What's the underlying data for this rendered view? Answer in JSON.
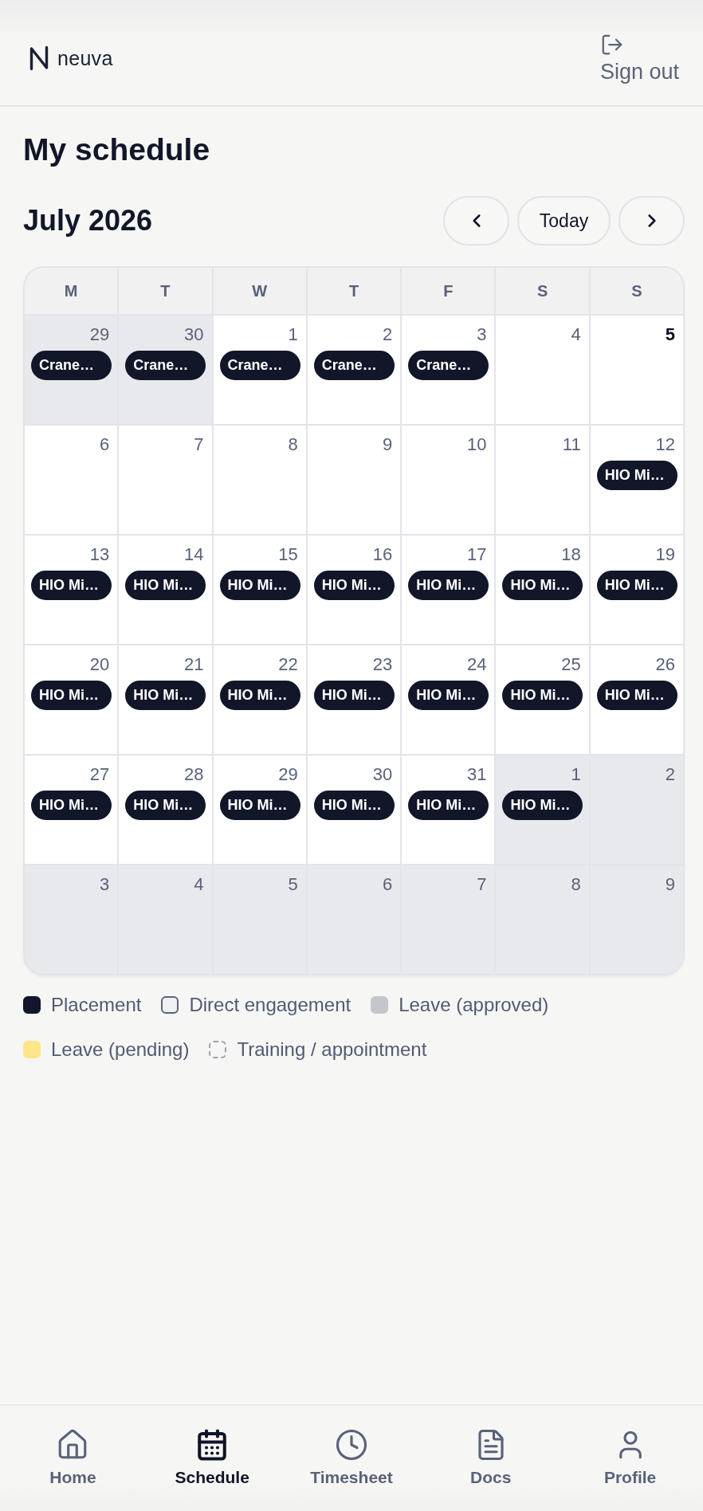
{
  "header": {
    "brand": "neuva",
    "sign_out": "Sign out"
  },
  "page_title": "My schedule",
  "month": {
    "title": "July 2026",
    "today_button": "Today"
  },
  "weekdays": [
    "M",
    "T",
    "W",
    "T",
    "F",
    "S",
    "S"
  ],
  "weeks": [
    {
      "days": [
        {
          "day": "29",
          "in_month": false,
          "today": false,
          "events": [
            {
              "label": "Crane…",
              "kind": "placement"
            }
          ]
        },
        {
          "day": "30",
          "in_month": false,
          "today": false,
          "events": [
            {
              "label": "Crane…",
              "kind": "placement"
            }
          ]
        },
        {
          "day": "1",
          "in_month": true,
          "today": false,
          "events": [
            {
              "label": "Crane…",
              "kind": "placement"
            }
          ]
        },
        {
          "day": "2",
          "in_month": true,
          "today": false,
          "events": [
            {
              "label": "Crane…",
              "kind": "placement"
            }
          ]
        },
        {
          "day": "3",
          "in_month": true,
          "today": false,
          "events": [
            {
              "label": "Crane…",
              "kind": "placement"
            }
          ]
        },
        {
          "day": "4",
          "in_month": true,
          "today": false
        },
        {
          "day": "5",
          "in_month": true,
          "today": true
        }
      ]
    },
    {
      "days": [
        {
          "day": "6",
          "in_month": true,
          "today": false
        },
        {
          "day": "7",
          "in_month": true,
          "today": false
        },
        {
          "day": "8",
          "in_month": true,
          "today": false
        },
        {
          "day": "9",
          "in_month": true,
          "today": false
        },
        {
          "day": "10",
          "in_month": true,
          "today": false
        },
        {
          "day": "11",
          "in_month": true,
          "today": false
        },
        {
          "day": "12",
          "in_month": true,
          "today": false,
          "events": [
            {
              "label": "HIO Mi…",
              "kind": "placement"
            }
          ]
        }
      ]
    },
    {
      "days": [
        {
          "day": "13",
          "in_month": true,
          "today": false,
          "events": [
            {
              "label": "HIO Mi…",
              "kind": "placement"
            }
          ]
        },
        {
          "day": "14",
          "in_month": true,
          "today": false,
          "events": [
            {
              "label": "HIO Mi…",
              "kind": "placement"
            }
          ]
        },
        {
          "day": "15",
          "in_month": true,
          "today": false,
          "events": [
            {
              "label": "HIO Mi…",
              "kind": "placement"
            }
          ]
        },
        {
          "day": "16",
          "in_month": true,
          "today": false,
          "events": [
            {
              "label": "HIO Mi…",
              "kind": "placement"
            }
          ]
        },
        {
          "day": "17",
          "in_month": true,
          "today": false,
          "events": [
            {
              "label": "HIO Mi…",
              "kind": "placement"
            }
          ]
        },
        {
          "day": "18",
          "in_month": true,
          "today": false,
          "events": [
            {
              "label": "HIO Mi…",
              "kind": "placement"
            }
          ]
        },
        {
          "day": "19",
          "in_month": true,
          "today": false,
          "events": [
            {
              "label": "HIO Mi…",
              "kind": "placement"
            }
          ]
        }
      ]
    },
    {
      "days": [
        {
          "day": "20",
          "in_month": true,
          "today": false,
          "events": [
            {
              "label": "HIO Mi…",
              "kind": "placement"
            }
          ]
        },
        {
          "day": "21",
          "in_month": true,
          "today": false,
          "events": [
            {
              "label": "HIO Mi…",
              "kind": "placement"
            }
          ]
        },
        {
          "day": "22",
          "in_month": true,
          "today": false,
          "events": [
            {
              "label": "HIO Mi…",
              "kind": "placement"
            }
          ]
        },
        {
          "day": "23",
          "in_month": true,
          "today": false,
          "events": [
            {
              "label": "HIO Mi…",
              "kind": "placement"
            }
          ]
        },
        {
          "day": "24",
          "in_month": true,
          "today": false,
          "events": [
            {
              "label": "HIO Mi…",
              "kind": "placement"
            }
          ]
        },
        {
          "day": "25",
          "in_month": true,
          "today": false,
          "events": [
            {
              "label": "HIO Mi…",
              "kind": "placement"
            }
          ]
        },
        {
          "day": "26",
          "in_month": true,
          "today": false,
          "events": [
            {
              "label": "HIO Mi…",
              "kind": "placement"
            }
          ]
        }
      ]
    },
    {
      "days": [
        {
          "day": "27",
          "in_month": true,
          "today": false,
          "events": [
            {
              "label": "HIO Mi…",
              "kind": "placement"
            }
          ]
        },
        {
          "day": "28",
          "in_month": true,
          "today": false,
          "events": [
            {
              "label": "HIO Mi…",
              "kind": "placement"
            }
          ]
        },
        {
          "day": "29",
          "in_month": true,
          "today": false,
          "events": [
            {
              "label": "HIO Mi…",
              "kind": "placement"
            }
          ]
        },
        {
          "day": "30",
          "in_month": true,
          "today": false,
          "events": [
            {
              "label": "HIO Mi…",
              "kind": "placement"
            }
          ]
        },
        {
          "day": "31",
          "in_month": true,
          "today": false,
          "events": [
            {
              "label": "HIO Mi…",
              "kind": "placement"
            }
          ]
        },
        {
          "day": "1",
          "in_month": false,
          "today": false,
          "events": [
            {
              "label": "HIO Mi…",
              "kind": "placement"
            }
          ]
        },
        {
          "day": "2",
          "in_month": false,
          "today": false
        }
      ]
    },
    {
      "days": [
        {
          "day": "3",
          "in_month": false,
          "today": false
        },
        {
          "day": "4",
          "in_month": false,
          "today": false
        },
        {
          "day": "5",
          "in_month": false,
          "today": false
        },
        {
          "day": "6",
          "in_month": false,
          "today": false
        },
        {
          "day": "7",
          "in_month": false,
          "today": false
        },
        {
          "day": "8",
          "in_month": false,
          "today": false
        },
        {
          "day": "9",
          "in_month": false,
          "today": false
        }
      ]
    }
  ],
  "legend": [
    {
      "kind": "placement",
      "label": "Placement"
    },
    {
      "kind": "direct_engagement",
      "label": "Direct engagement"
    },
    {
      "kind": "leave_approved",
      "label": "Leave (approved)"
    },
    {
      "kind": "leave_pending",
      "label": "Leave (pending)"
    },
    {
      "kind": "training",
      "label": "Training / appointment"
    }
  ],
  "nav": [
    {
      "label": "Home",
      "selected": false
    },
    {
      "label": "Schedule",
      "selected": true
    },
    {
      "label": "Timesheet",
      "selected": false
    },
    {
      "label": "Docs",
      "selected": false
    },
    {
      "label": "Profile",
      "selected": false
    }
  ]
}
